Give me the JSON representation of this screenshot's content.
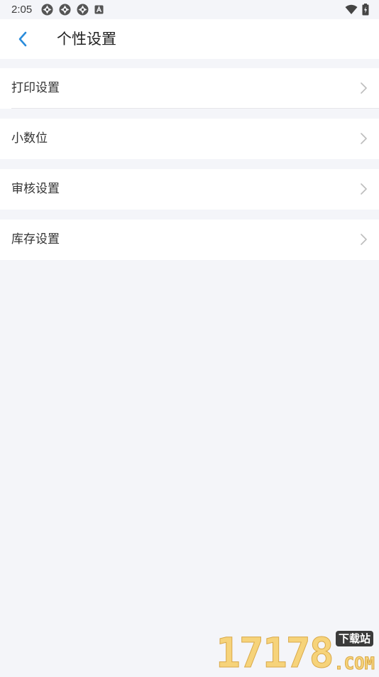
{
  "status_bar": {
    "time": "2:05",
    "left_icons": [
      "aperture-icon",
      "aperture-icon",
      "aperture-icon",
      "a-badge-icon"
    ],
    "right_icons": [
      "wifi-icon",
      "battery-charging-icon"
    ]
  },
  "header": {
    "back_icon": "chevron-left-icon",
    "title": "个性设置",
    "accent_color": "#2a8cdb"
  },
  "settings": {
    "items": [
      {
        "label": "打印设置"
      },
      {
        "label": "小数位"
      },
      {
        "label": "审核设置"
      },
      {
        "label": "库存设置"
      }
    ]
  },
  "watermark": {
    "digits": "17178",
    "badge": "下载站",
    "suffix": ".COM"
  },
  "colors": {
    "background": "#f4f5f9",
    "card": "#ffffff",
    "text": "#333333",
    "chevron": "#bdbdbd"
  }
}
